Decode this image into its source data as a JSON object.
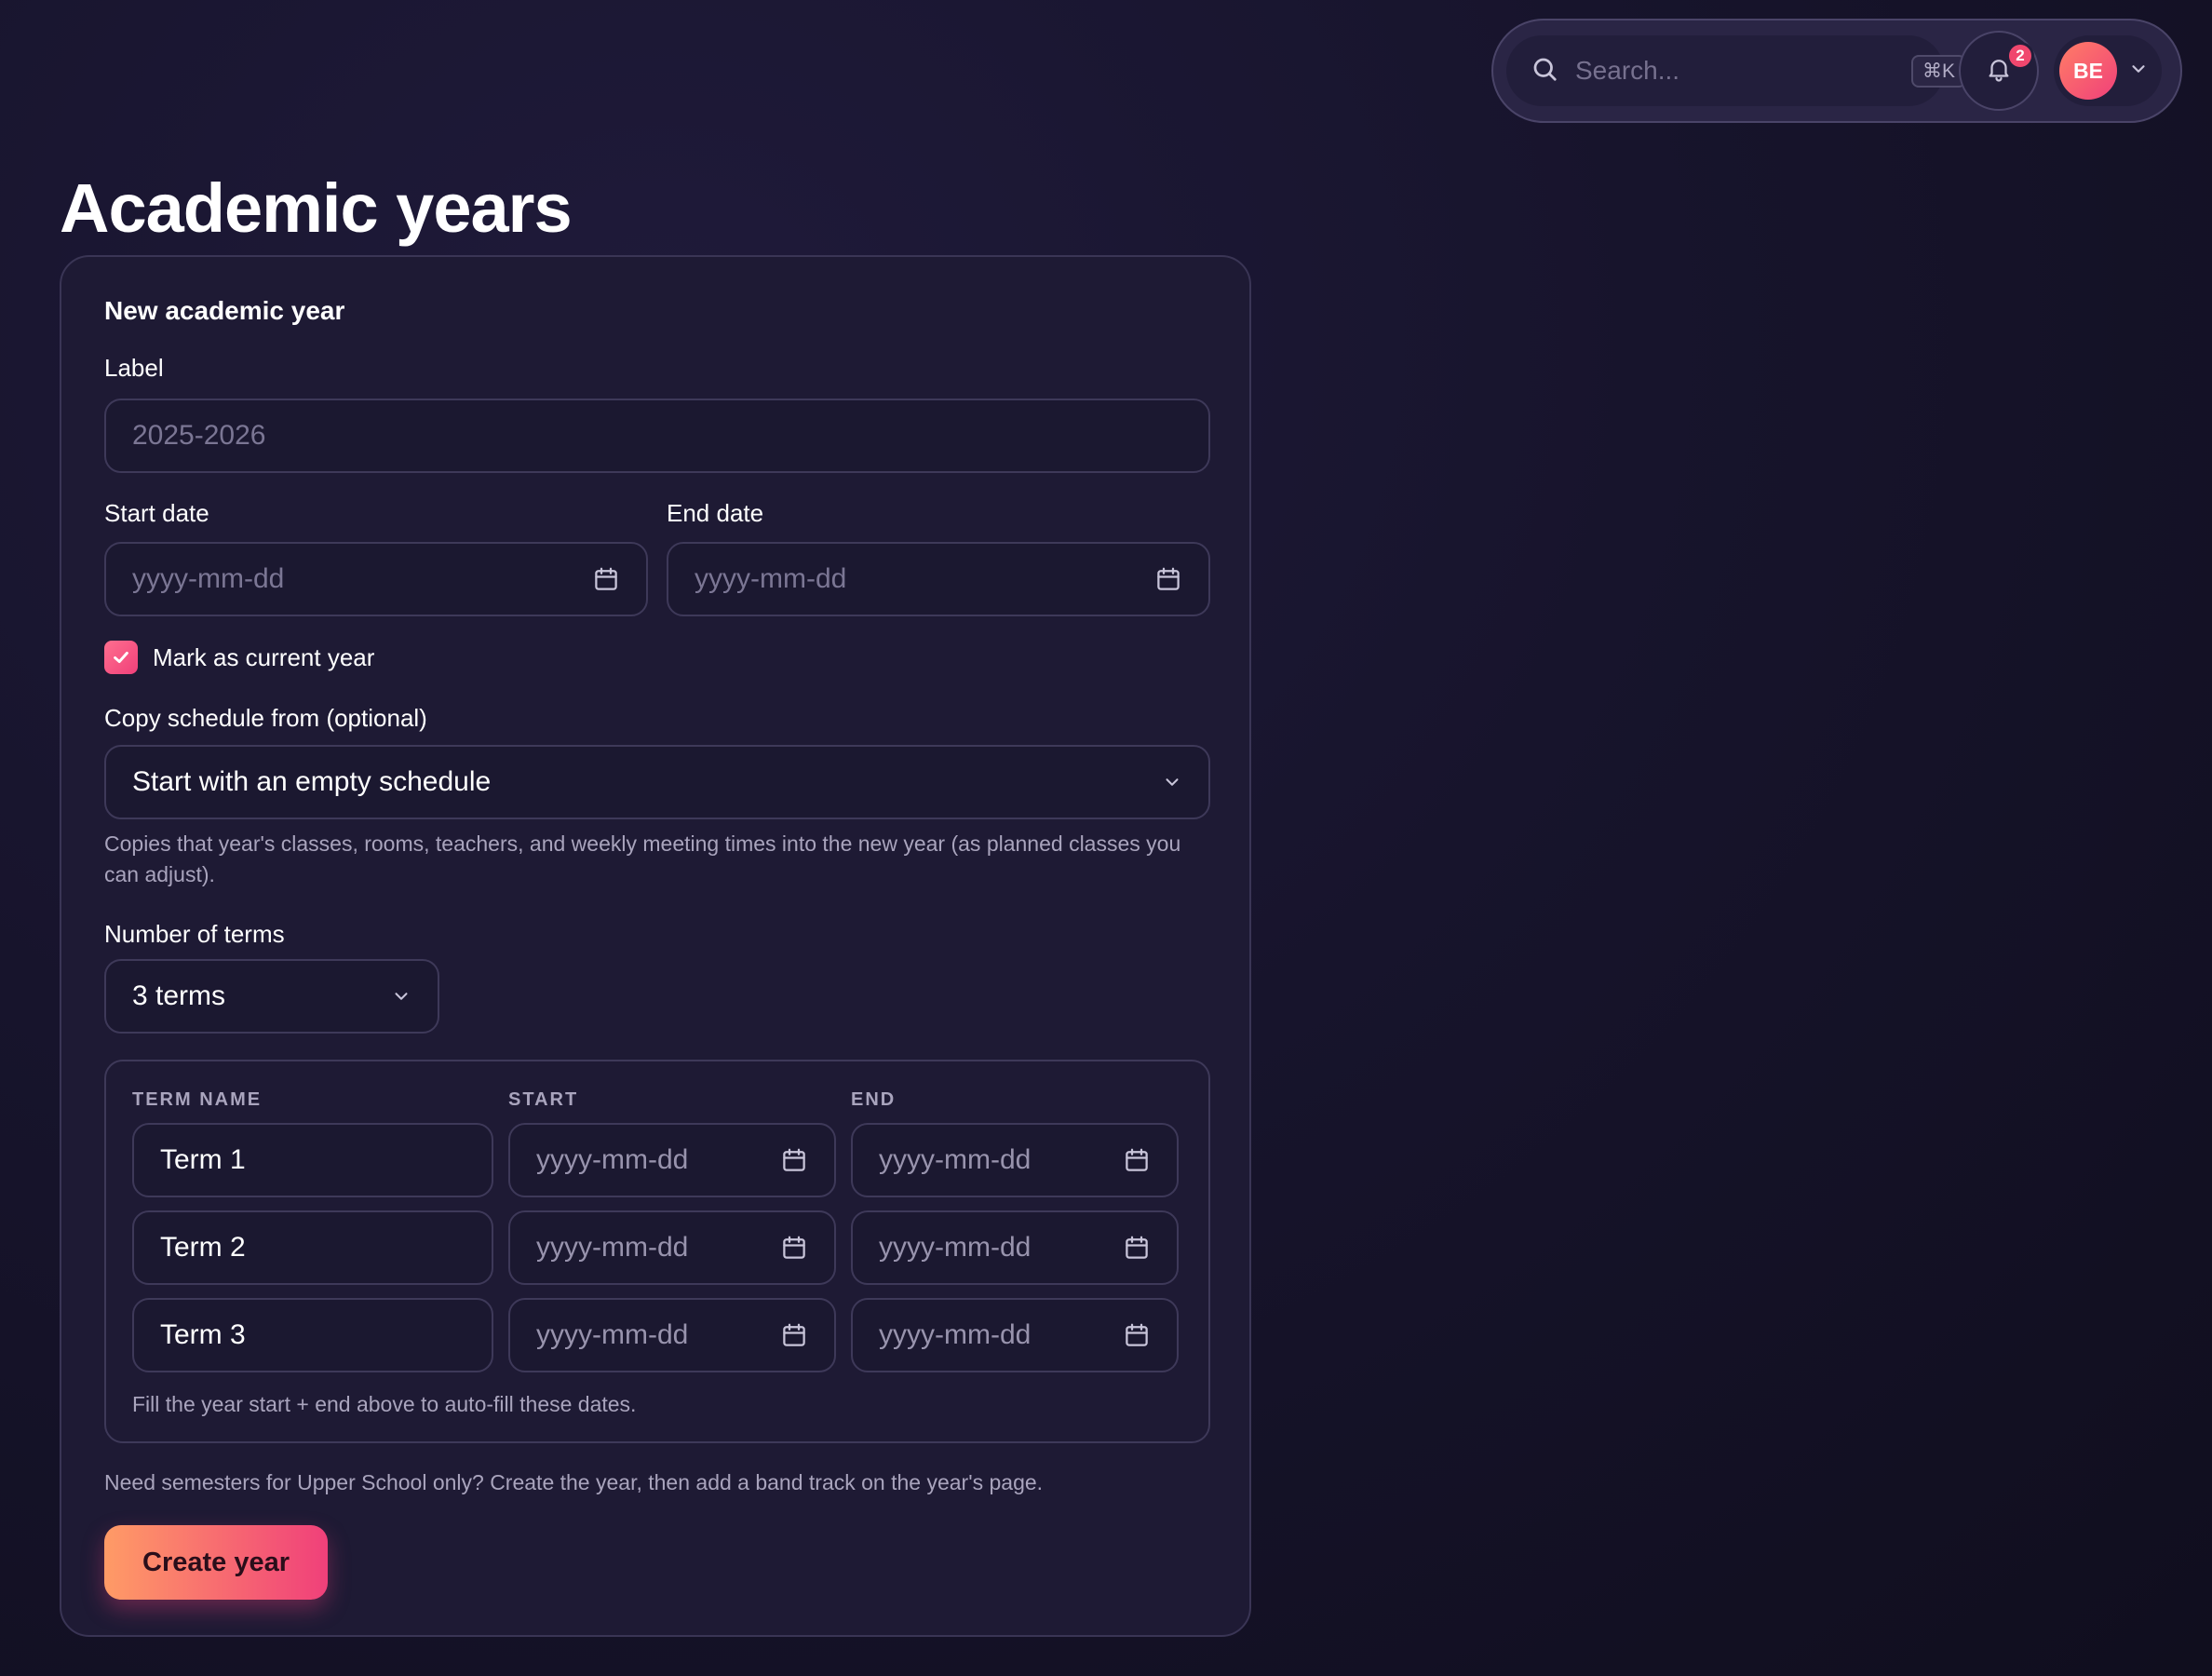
{
  "header": {
    "search": {
      "placeholder": "Search...",
      "shortcut": "⌘K"
    },
    "notifications": {
      "count": "2"
    },
    "user": {
      "initials": "BE"
    }
  },
  "page": {
    "title": "Academic years"
  },
  "form": {
    "heading": "New academic year",
    "label": {
      "label": "Label",
      "placeholder": "2025-2026"
    },
    "start_date": {
      "label": "Start date",
      "placeholder": "yyyy-mm-dd"
    },
    "end_date": {
      "label": "End date",
      "placeholder": "yyyy-mm-dd"
    },
    "mark_current": {
      "label": "Mark as current year",
      "checked": true
    },
    "copy_schedule": {
      "label": "Copy schedule from (optional)",
      "selected": "Start with an empty schedule",
      "helper": "Copies that year's classes, rooms, teachers, and weekly meeting times into the new year (as planned classes you can adjust)."
    },
    "number_of_terms": {
      "label": "Number of terms",
      "selected": "3 terms"
    },
    "terms_table": {
      "headers": {
        "name": "TERM NAME",
        "start": "START",
        "end": "END"
      },
      "rows": [
        {
          "name": "Term 1",
          "start": "yyyy-mm-dd",
          "end": "yyyy-mm-dd"
        },
        {
          "name": "Term 2",
          "start": "yyyy-mm-dd",
          "end": "yyyy-mm-dd"
        },
        {
          "name": "Term 3",
          "start": "yyyy-mm-dd",
          "end": "yyyy-mm-dd"
        }
      ],
      "helper": "Fill the year start + end above to auto-fill these dates."
    },
    "note": "Need semesters for Upper School only? Create the year, then add a band track on the year's page.",
    "submit_label": "Create year"
  },
  "colors": {
    "background": "#17142c",
    "card": "#1e1a34",
    "accent_start": "#ff9b66",
    "accent_end": "#f0407a"
  }
}
